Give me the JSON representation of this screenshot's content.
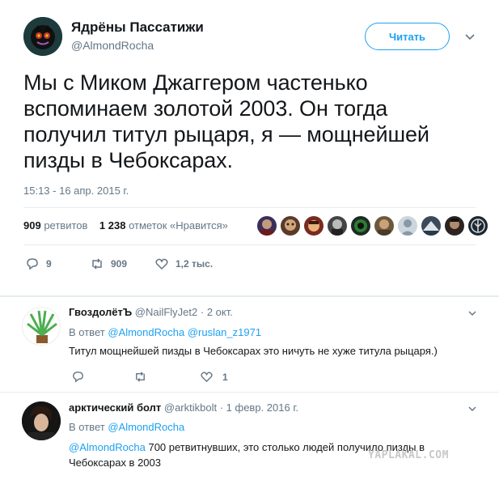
{
  "tweet": {
    "author_name": "Ядрёны Пассатижи",
    "author_handle": "@AlmondRocha",
    "follow_label": "Читать",
    "text": "Мы с Миком Джаггером частенько вспоминаем золотой 2003. Он тогда получил титул рыцаря, я — мощнейшей пизды в Чебоксарах.",
    "timestamp": "15:13 - 16 апр. 2015 г.",
    "retweets_count": "909",
    "retweets_label": "ретвитов",
    "likes_count": "1 238",
    "likes_label": "отметок «Нравится»",
    "actions": {
      "replies": "9",
      "retweets": "909",
      "likes": "1,2 тыс."
    }
  },
  "replies": [
    {
      "name": "ГвоздолётЪ",
      "handle": "@NailFlyJet2",
      "date": "· 2 окт.",
      "reply_to_label": "В ответ",
      "reply_to_1": "@AlmondRocha",
      "reply_to_2": "@ruslan_z1971",
      "text": "Титул мощнейшей пизды в Чебоксарах это ничуть не хуже титула рыцаря.)",
      "likes": "1"
    },
    {
      "name": "арктический болт",
      "handle": "@arktikbolt",
      "date": "· 1 февр. 2016 г.",
      "reply_to_label": "В ответ",
      "reply_to_1": "@AlmondRocha",
      "mention": "@AlmondRocha",
      "text": " 700 ретвитнувших, это столько людей получило пизды в Чебоксарах в 2003"
    }
  ],
  "watermark": "YAPLAKAL.COM",
  "colors": {
    "accent": "#1da1f2",
    "muted": "#657786",
    "text": "#14171a",
    "divider": "#e6ecf0"
  }
}
